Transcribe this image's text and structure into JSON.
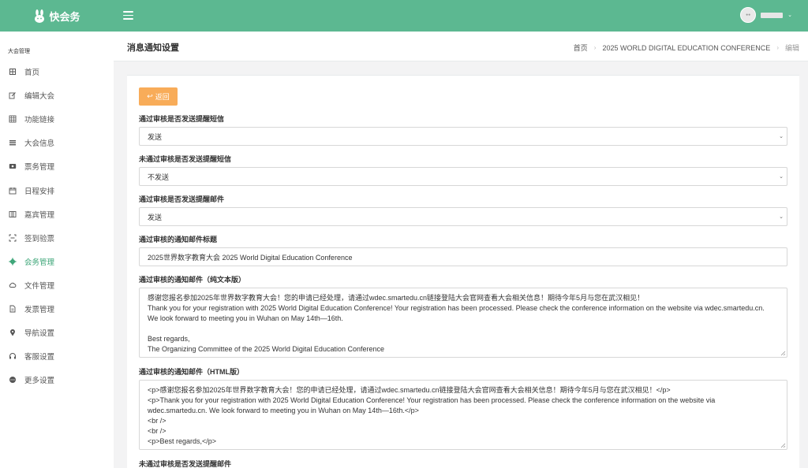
{
  "brand": {
    "name": "快会务",
    "logo_icon": "rabbit-icon"
  },
  "header": {
    "menu_icon": "hamburger-icon",
    "user_caret": "chevron-down-icon"
  },
  "sidebar": {
    "section": "大会管理",
    "items": [
      {
        "label": "首页",
        "icon": "home-icon"
      },
      {
        "label": "编辑大会",
        "icon": "edit-icon"
      },
      {
        "label": "功能链接",
        "icon": "grid-icon"
      },
      {
        "label": "大会信息",
        "icon": "list-icon"
      },
      {
        "label": "票务管理",
        "icon": "ticket-icon"
      },
      {
        "label": "日程安排",
        "icon": "calendar-icon"
      },
      {
        "label": "嘉宾管理",
        "icon": "guest-icon"
      },
      {
        "label": "签到验票",
        "icon": "qrcode-icon"
      },
      {
        "label": "会务管理",
        "icon": "gear-icon",
        "active": true
      },
      {
        "label": "文件管理",
        "icon": "cloud-icon"
      },
      {
        "label": "发票管理",
        "icon": "file-icon"
      },
      {
        "label": "导航设置",
        "icon": "map-pin-icon"
      },
      {
        "label": "客服设置",
        "icon": "headset-icon"
      },
      {
        "label": "更多设置",
        "icon": "more-icon"
      }
    ]
  },
  "page": {
    "title": "消息通知设置",
    "breadcrumb": [
      "首页",
      "2025 WORLD DIGITAL EDUCATION CONFERENCE",
      "编辑"
    ]
  },
  "form": {
    "back_label": "返回",
    "approve_sms": {
      "label": "通过审核是否发送提醒短信",
      "value": "发送"
    },
    "reject_sms": {
      "label": "未通过审核是否发送提醒短信",
      "value": "不发送"
    },
    "approve_email": {
      "label": "通过审核是否发送提醒邮件",
      "value": "发送"
    },
    "approve_email_title": {
      "label": "通过审核的通知邮件标题",
      "value": "2025世界数字教育大会 2025 World Digital Education Conference"
    },
    "approve_email_text": {
      "label": "通过审核的通知邮件（纯文本版）",
      "lines": [
        "感谢您报名参加2025年世界数字教育大会！您的申请已经处理，请通过wdec.smartedu.cn链接登陆大会官网查看大会相关信息！期待今年5月与您在武汉相见！",
        "Thank you for your registration with 2025 World Digital Education Conference! Your registration has been processed. Please check the conference information on the website via wdec.smartedu.cn.",
        "We look forward to meeting you in Wuhan on May 14th—16th.",
        "",
        "Best regards,",
        "The Organizing Committee of the 2025 World Digital Education Conference"
      ]
    },
    "approve_email_html": {
      "label": "通过审核的通知邮件（HTML版）",
      "lines": [
        "<p>感谢您报名参加2025年世界数字教育大会！您的申请已经处理，请通过wdec.smartedu.cn链接登陆大会官网查看大会相关信息！期待今年5月与您在武汉相见！</p>",
        "<p>Thank you for your registration with 2025 World Digital Education Conference! Your registration has been processed. Please check the conference information on the website via",
        "wdec.smartedu.cn. We look forward to meeting you in Wuhan on May 14th—16th.</p>",
        "<br />",
        "<br />",
        "<p>Best regards,</p>"
      ]
    },
    "reject_email": {
      "label": "未通过审核是否发送提醒邮件"
    }
  },
  "colors": {
    "topbar": "#5cb891",
    "accent": "#3aa476",
    "back_button": "#f8ac59"
  }
}
